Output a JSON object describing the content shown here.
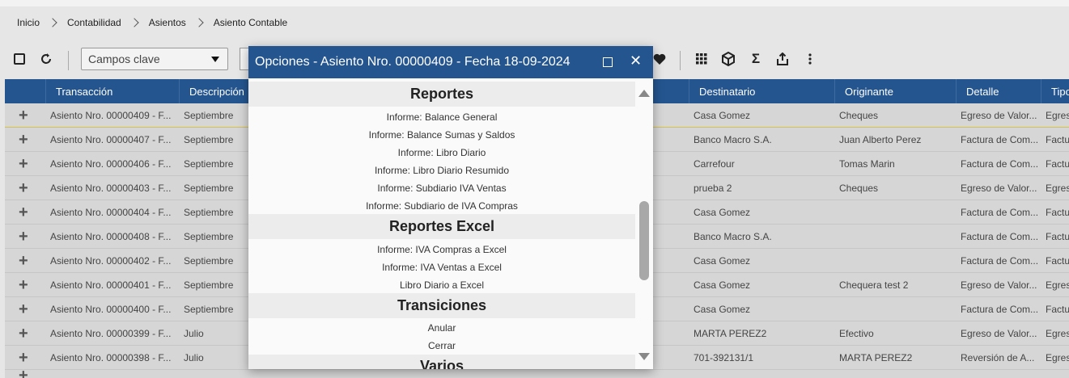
{
  "breadcrumb": [
    "Inicio",
    "Contabilidad",
    "Asientos",
    "Asiento Contable"
  ],
  "toolbar": {
    "filter_select": "Campos clave"
  },
  "grid": {
    "columns": [
      "",
      "Transacción",
      "Descripción",
      "Destinatario",
      "Originante",
      "Detalle",
      "Tipo"
    ],
    "rows": [
      {
        "trans": "Asiento Nro. 00000409 - F...",
        "desc": "Septiembre",
        "dest": "Casa Gomez",
        "orig": "Cheques",
        "detalle": "Egreso de Valor...",
        "tipo": "Egres"
      },
      {
        "trans": "Asiento Nro. 00000407 - F...",
        "desc": "Septiembre",
        "dest": "Banco Macro S.A.",
        "orig": "Juan Alberto Perez",
        "detalle": "Factura de Com...",
        "tipo": "Factu"
      },
      {
        "trans": "Asiento Nro. 00000406 - F...",
        "desc": "Septiembre",
        "dest": "Carrefour",
        "orig": "Tomas Marin",
        "detalle": "Factura de Com...",
        "tipo": "Factu"
      },
      {
        "trans": "Asiento Nro. 00000403 - F...",
        "desc": "Septiembre",
        "dest": "prueba 2",
        "orig": "Cheques",
        "detalle": "Egreso de Valor...",
        "tipo": "Egres"
      },
      {
        "trans": "Asiento Nro. 00000404 - F...",
        "desc": "Septiembre",
        "dest": "Casa Gomez",
        "orig": "",
        "detalle": "Factura de Com...",
        "tipo": "Factu"
      },
      {
        "trans": "Asiento Nro. 00000408 - F...",
        "desc": "Septiembre",
        "dest": "Banco Macro S.A.",
        "orig": "",
        "detalle": "Factura de Com...",
        "tipo": "Factu"
      },
      {
        "trans": "Asiento Nro. 00000402 - F...",
        "desc": "Septiembre",
        "dest": "Casa Gomez",
        "orig": "",
        "detalle": "Factura de Com...",
        "tipo": "Factu"
      },
      {
        "trans": "Asiento Nro. 00000401 - F...",
        "desc": "Septiembre",
        "dest": "Casa Gomez",
        "orig": "Chequera test 2",
        "detalle": "Egreso de Valor...",
        "tipo": "Egres"
      },
      {
        "trans": "Asiento Nro. 00000400 - F...",
        "desc": "Septiembre",
        "dest": "Casa Gomez",
        "orig": "",
        "detalle": "Factura de Com...",
        "tipo": "Factu"
      },
      {
        "trans": "Asiento Nro. 00000399 - F...",
        "desc": "Julio",
        "dest": "MARTA PEREZ2",
        "orig": "Efectivo",
        "detalle": "Egreso de Valor...",
        "tipo": "Egres"
      },
      {
        "trans": "Asiento Nro. 00000398 - F...",
        "desc": "Julio",
        "dest": "701-392131/1",
        "orig": "MARTA PEREZ2",
        "detalle": "Reversión de A...",
        "tipo": "Egres"
      }
    ]
  },
  "modal": {
    "title": "Opciones - Asiento Nro. 00000409 - Fecha 18-09-2024",
    "sections": [
      {
        "title": "Reportes",
        "items": [
          "Informe: Balance General",
          "Informe: Balance Sumas y Saldos",
          "Informe: Libro Diario",
          "Informe: Libro Diario Resumido",
          "Informe: Subdiario IVA Ventas",
          "Informe: Subdiario de IVA Compras"
        ]
      },
      {
        "title": "Reportes Excel",
        "items": [
          "Informe: IVA Compras a Excel",
          "Informe: IVA Ventas a Excel",
          "Libro Diario a Excel"
        ]
      },
      {
        "title": "Transiciones",
        "items": [
          "Anular",
          "Cerrar"
        ]
      },
      {
        "title": "Varios",
        "items": []
      }
    ]
  },
  "icons": {
    "select_all": "checkbox-icon",
    "refresh": "refresh-icon",
    "favorite": "heart-icon",
    "columns": "grid-icon",
    "package": "cube-icon",
    "sum": "sigma-icon",
    "export": "export-icon",
    "more": "more-vertical-icon"
  },
  "colors": {
    "header_blue": "#24558f",
    "row_gray": "#d6d6d6",
    "background": "#e6e6e6"
  }
}
